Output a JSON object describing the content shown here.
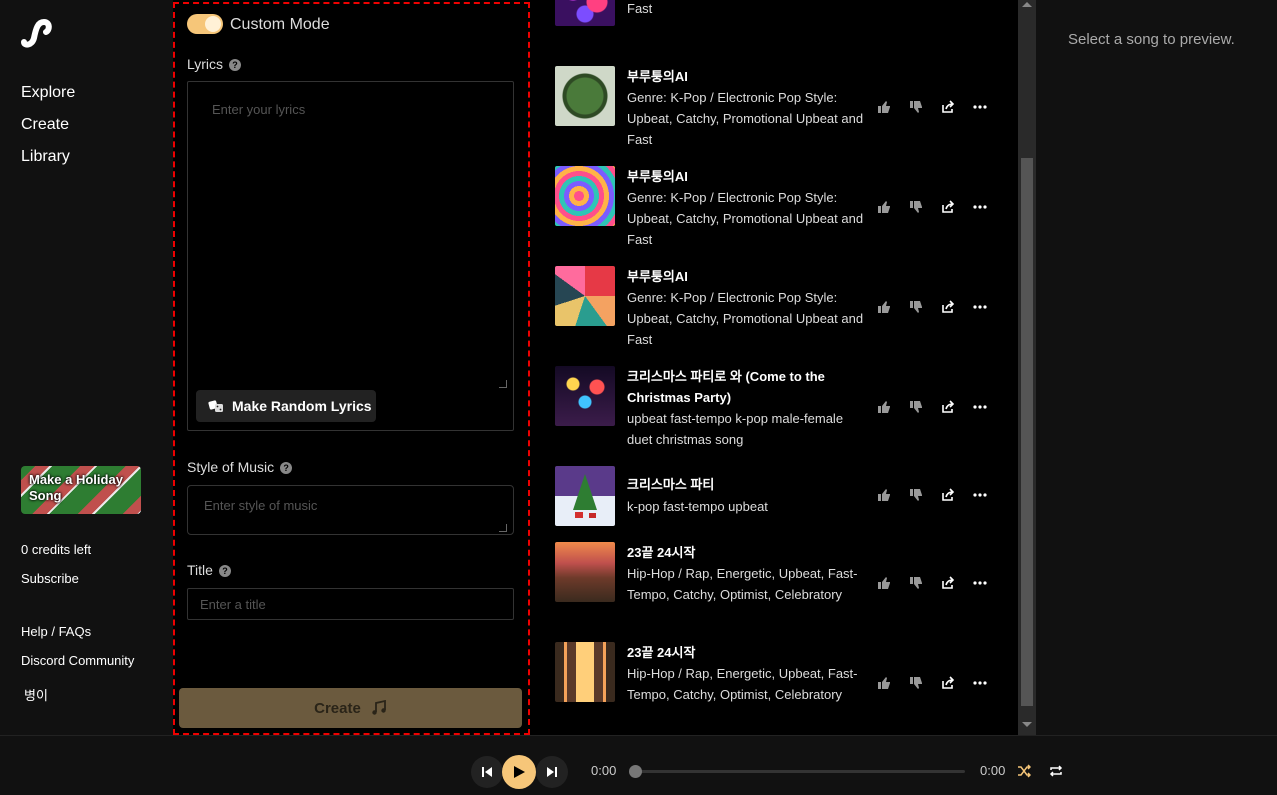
{
  "sidebar": {
    "nav": [
      {
        "label": "Explore"
      },
      {
        "label": "Create"
      },
      {
        "label": "Library"
      }
    ],
    "holiday_button": "Make a Holiday Song",
    "credits": "0 credits left",
    "subscribe": "Subscribe",
    "help": "Help / FAQs",
    "discord": "Discord Community",
    "user": "병이"
  },
  "create": {
    "custom_mode_label": "Custom Mode",
    "custom_mode_on": true,
    "lyrics_label": "Lyrics",
    "lyrics_placeholder": "Enter your lyrics",
    "random_lyrics_button": "Make Random Lyrics",
    "style_label": "Style of Music",
    "style_placeholder": "Enter style of music",
    "title_label": "Title",
    "title_placeholder": "Enter a title",
    "create_button": "Create"
  },
  "songs": [
    {
      "title": "",
      "desc": "Genre: K-Pop / Electronic Pop Style: Upbeat, Catchy, Promotional Upbeat and Fast",
      "thumb": "party-balloons"
    },
    {
      "title": "부루퉁의AI",
      "desc": "Genre: K-Pop / Electronic Pop Style: Upbeat, Catchy, Promotional Upbeat and Fast",
      "thumb": "green-globe"
    },
    {
      "title": "부루퉁의AI",
      "desc": "Genre: K-Pop / Electronic Pop Style: Upbeat, Catchy, Promotional Upbeat and Fast",
      "thumb": "psychedelic-swirl"
    },
    {
      "title": "부루퉁의AI",
      "desc": "Genre: K-Pop / Electronic Pop Style: Upbeat, Catchy, Promotional Upbeat and Fast",
      "thumb": "geometric-mosaic"
    },
    {
      "title": "크리스마스 파티로 와 (Come to the Christmas Party)",
      "desc": "upbeat fast-tempo k-pop male-female duet christmas song",
      "thumb": "fireworks"
    },
    {
      "title": "크리스마스 파티",
      "desc": "k-pop fast-tempo upbeat",
      "thumb": "snowy-christmas-tree"
    },
    {
      "title": "23끝 24시작",
      "desc": "Hip-Hop / Rap, Energetic, Upbeat, Fast-Tempo, Catchy, Optimist, Celebratory",
      "thumb": "sunset-road"
    },
    {
      "title": "23끝 24시작",
      "desc": "Hip-Hop / Rap, Energetic, Upbeat, Fast-Tempo, Catchy, Optimist, Celebratory",
      "thumb": "city-sunset"
    }
  ],
  "preview": {
    "text": "Select a song to preview."
  },
  "player": {
    "current_time": "0:00",
    "duration": "0:00",
    "progress": 0
  },
  "colors": {
    "accent": "#f6c679",
    "create_button": "#6b5a3e"
  }
}
